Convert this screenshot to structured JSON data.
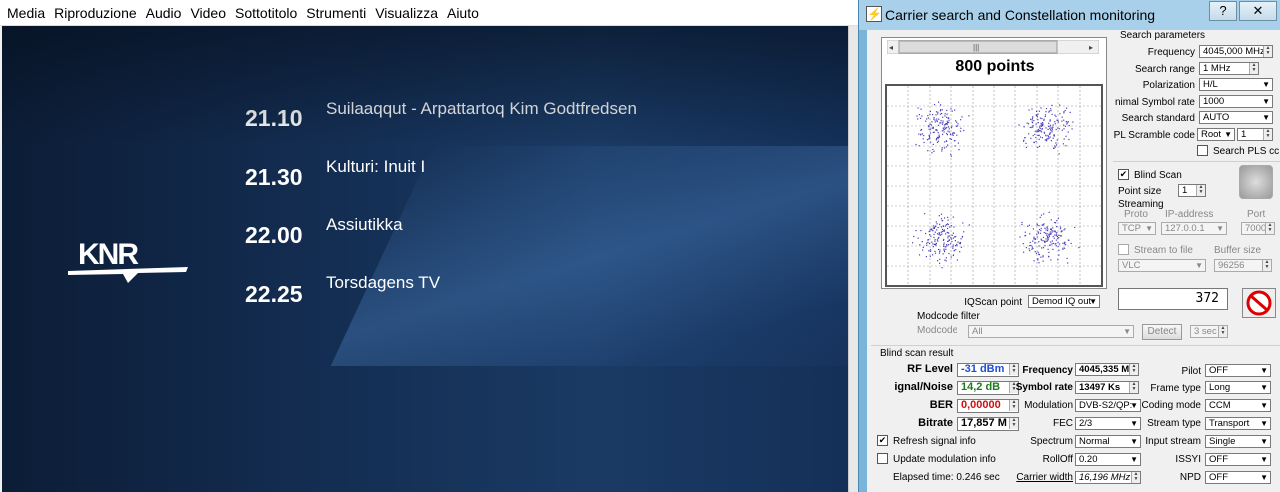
{
  "vlc": {
    "menu": [
      "Media",
      "Riproduzione",
      "Audio",
      "Video",
      "Sottotitolo",
      "Strumenti",
      "Visualizza",
      "Aiuto"
    ],
    "logo_text": "KNR",
    "schedule": [
      {
        "time": "21.10",
        "title": "Suilaaqqut - Arpattartoq Kim Godtfredsen"
      },
      {
        "time": "21.30",
        "title": "Kulturi: Inuit I"
      },
      {
        "time": "22.00",
        "title": "Assiutikka"
      },
      {
        "time": "22.25",
        "title": "Torsdagens TV"
      }
    ]
  },
  "window": {
    "title": "Carrier search and Constellation monitoring",
    "help_glyph": "?",
    "close_glyph": "✕",
    "constellation": {
      "points_label": "800 points"
    },
    "search": {
      "group_title": "Search parameters",
      "frequency": {
        "label": "Frequency",
        "value": "4045,000 MHz"
      },
      "range": {
        "label": "Search range",
        "value": "1 MHz"
      },
      "polarization": {
        "label": "Polarization",
        "value": "H/L"
      },
      "min_sr": {
        "label": "nimal Symbol rate",
        "value": "1000"
      },
      "standard": {
        "label": "Search standard",
        "value": "AUTO"
      },
      "pls": {
        "label": "PL Scramble code",
        "mode": "Root",
        "value": "1"
      },
      "search_pls": "Search PLS cc"
    },
    "blind": {
      "label": "Blind Scan",
      "point_size_label": "Point size",
      "point_size": "1"
    },
    "streaming": {
      "title": "Streaming",
      "proto_label": "Proto",
      "ip_label": "IP-address",
      "port_label": "Port",
      "proto": "TCP",
      "ip": "127.0.0.1",
      "port": "7000",
      "stream_to_file": "Stream to file",
      "buffer_label": "Buffer size",
      "player": "VLC",
      "buffer": "96256"
    },
    "iq": {
      "label": "IQScan point",
      "value": "Demod IQ out",
      "counter": "372"
    },
    "modcode": {
      "title": "Modcode filter",
      "label": "Modcode",
      "value": "All",
      "detect": "Detect",
      "seconds": "3 sec"
    },
    "result": {
      "title": "Blind scan result",
      "rf_label": "RF Level",
      "rf": "-31 dBm",
      "snr_label": "ignal/Noise",
      "snr": "14,2 dB",
      "ber_label": "BER",
      "ber": "0,00000",
      "bitrate_label": "Bitrate",
      "bitrate": "17,857 M",
      "freq_label": "Frequency",
      "freq": "4045,335 M",
      "sr_label": "Symbol rate",
      "sr": "13497 Ks",
      "mod_label": "Modulation",
      "mod": "DVB-S2/QP:",
      "fec_label": "FEC",
      "fec": "2/3",
      "spectrum_label": "Spectrum",
      "spectrum": "Normal",
      "rolloff_label": "RollOff",
      "rolloff": "0.20",
      "carrier_label": "Carrier width",
      "carrier": "16,196 MHz",
      "pilot_label": "Pilot",
      "pilot": "OFF",
      "frame_label": "Frame type",
      "frame": "Long",
      "coding_label": "Coding mode",
      "coding": "CCM",
      "stype_label": "Stream type",
      "stype": "Transport",
      "input_label": "Input stream",
      "input": "Single",
      "issyi_label": "ISSYI",
      "issyi": "OFF",
      "npd_label": "NPD",
      "npd": "OFF",
      "refresh": "Refresh signal info",
      "update": "Update modulation info",
      "elapsed": "Elapsed time: 0.246 sec"
    },
    "colors": {
      "rf": "#1f4fd0",
      "snr": "#1d7a1d",
      "ber": "#cc1111"
    }
  }
}
